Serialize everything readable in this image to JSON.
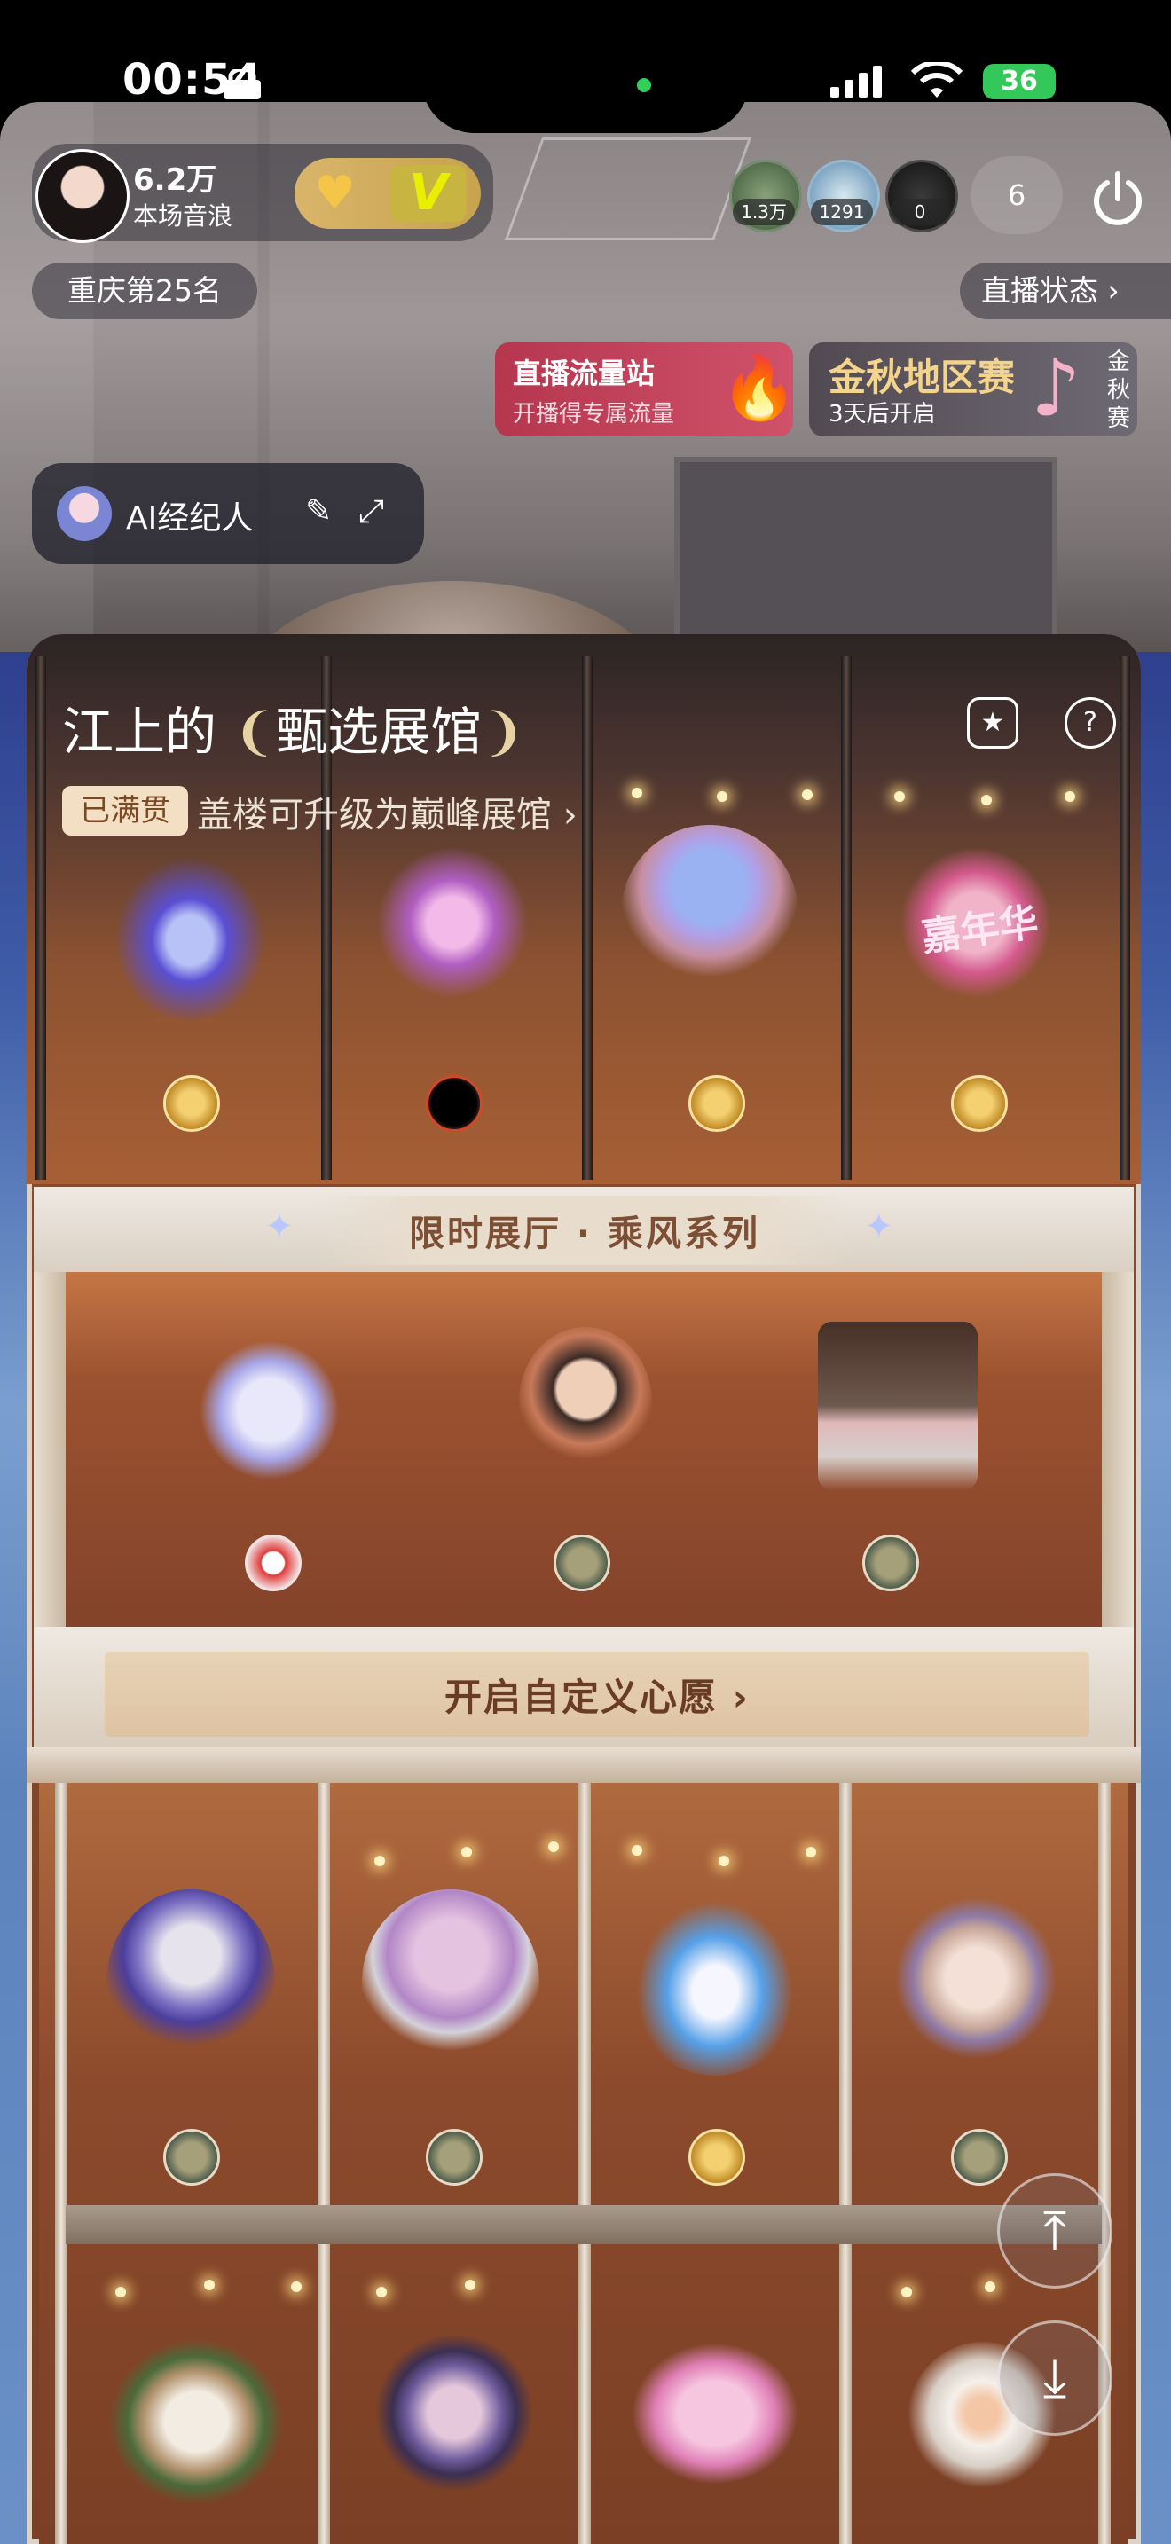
{
  "status_bar": {
    "time": "00:54",
    "battery": "36"
  },
  "host": {
    "fans_count": "6.2万",
    "fans_label": "本场音浪"
  },
  "viewers": [
    {
      "count": "1.3万"
    },
    {
      "count": "1291"
    },
    {
      "count": "0"
    }
  ],
  "online_count": "6",
  "rank": "重庆第25名",
  "live_status": "直播状态",
  "flow_station": {
    "title": "直播流量站",
    "subtitle": "开播得专属流量"
  },
  "golden_autumn": {
    "title": "金秋地区赛",
    "subtitle": "3天后开启",
    "vertical": [
      "金",
      "秋",
      "赛"
    ]
  },
  "ai_agent": {
    "label": "AI经纪人"
  },
  "gallery": {
    "title": "江上的",
    "hall_name": "甄选展馆",
    "badge": "已满贯",
    "upgrade_text": "盖楼可升级为巅峰展馆",
    "top_gift_logo_text": "嘉年华"
  },
  "limited_hall": {
    "title": "限时展厅 · 乘风系列"
  },
  "wish": {
    "label": "开启自定义心愿"
  },
  "icons": {
    "chevron": "›",
    "power": "⏻",
    "star": "★",
    "question": "?",
    "up": "⤒",
    "down": "⤓",
    "edit": "✎",
    "expand": "⤢",
    "fire": "🔥",
    "sparkle": "✦"
  },
  "colors": {
    "gold": "#f4d38a",
    "flow_red": "#b5364e",
    "brown_text": "#6a3b25"
  }
}
